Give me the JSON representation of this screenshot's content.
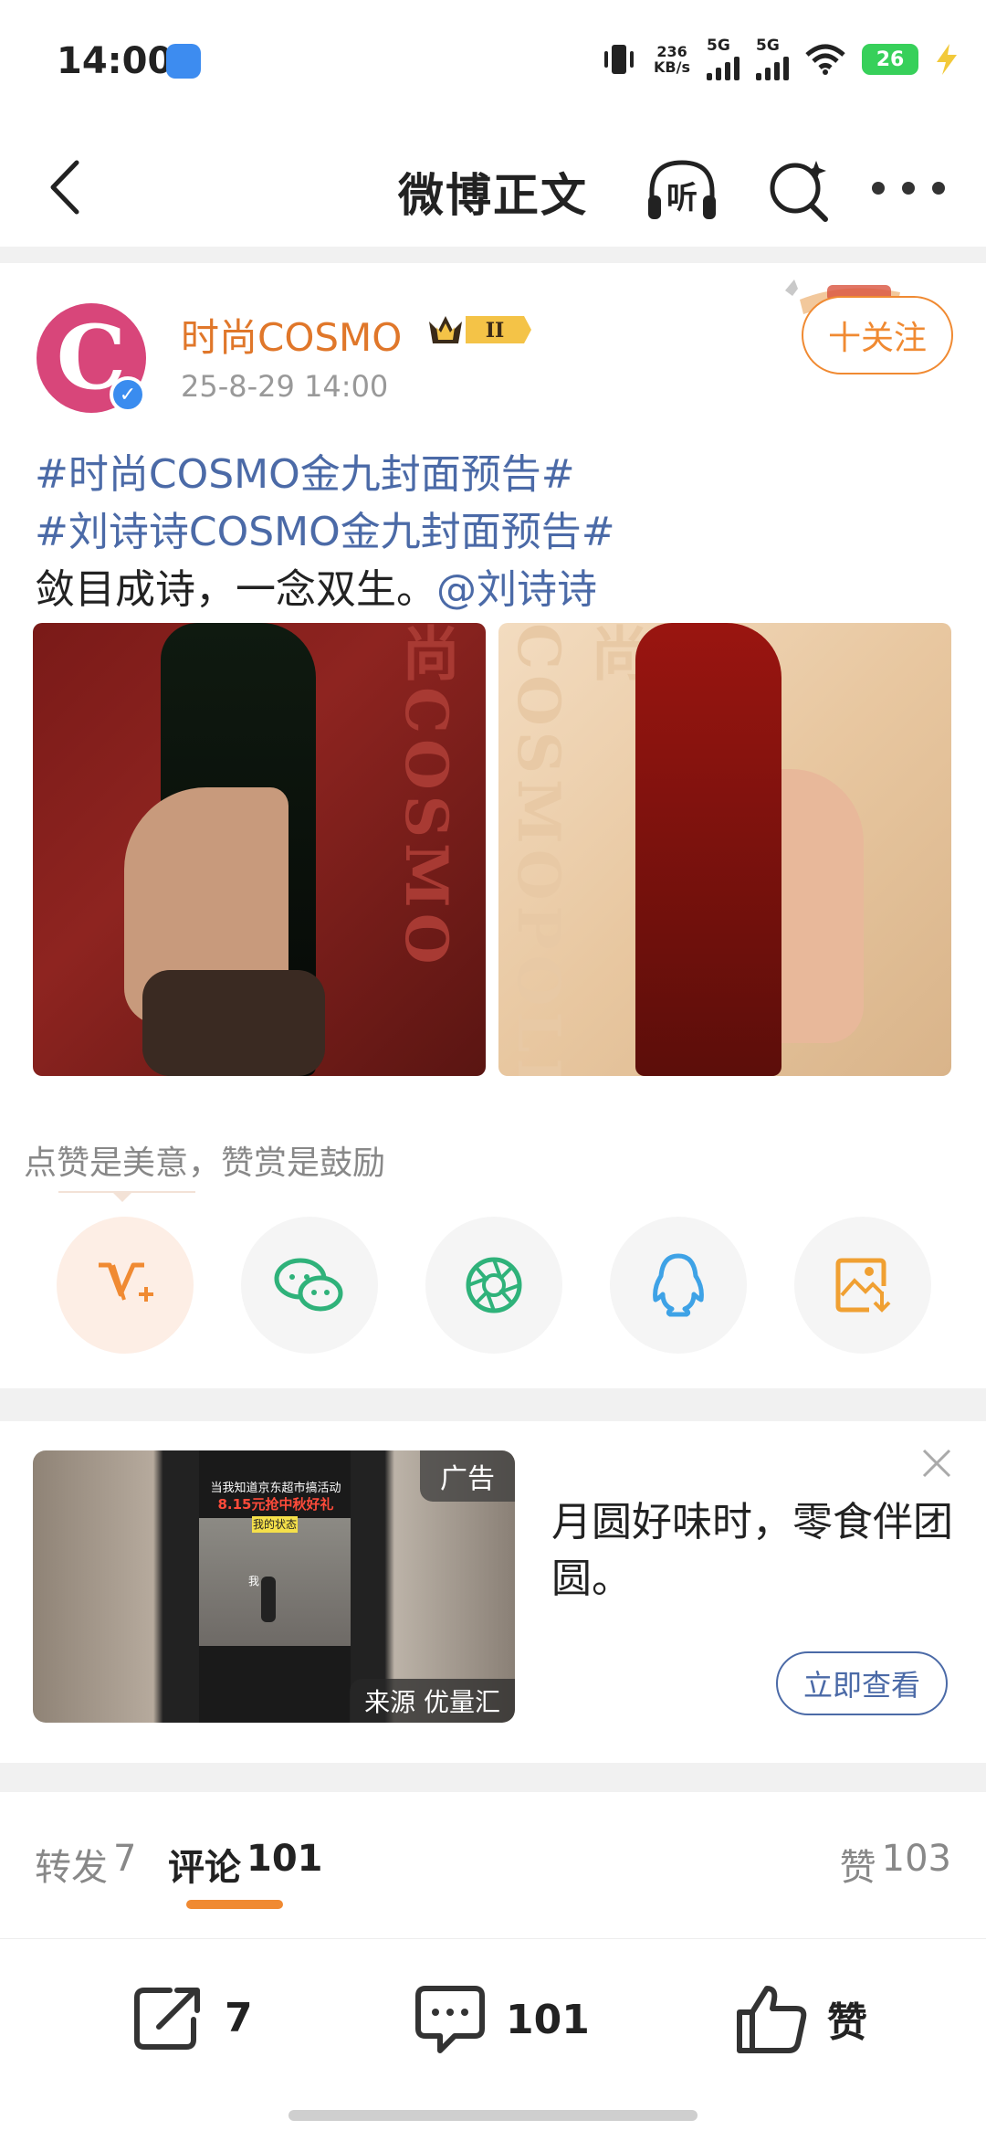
{
  "status_bar": {
    "time": "14:00",
    "net_speed_value": "236",
    "net_speed_unit": "KB/s",
    "sim1": "5G",
    "sim2": "5G",
    "battery": "26"
  },
  "nav": {
    "title": "微博正文",
    "listen_label": "听"
  },
  "post": {
    "author": "时尚COSMO",
    "vip_level": "II",
    "timestamp": "25-8-29 14:00",
    "follow_label": "十关注",
    "hashtag1": "#时尚COSMO金九封面预告#",
    "hashtag2": "#刘诗诗COSMO金九封面预告#",
    "body_text": "敛目成诗，一念双生。",
    "mention": "@刘诗诗",
    "image_watermark1": "尚COSMO",
    "image_watermark2": "尚COSMOPOLI"
  },
  "praise_tip": "点赞是美意，赞赏是鼓励",
  "share_targets": [
    "reward",
    "wechat",
    "moments",
    "qq",
    "save-image"
  ],
  "ad": {
    "badge": "广告",
    "source": "来源 优量汇",
    "title": "月圆好味时，零食伴团圆。",
    "cta": "立即查看",
    "video_caption1": "当我知道京东超市搞活动",
    "video_caption2": "8.15元抢中秋好礼",
    "video_caption3": "我的状态",
    "video_person_label": "我"
  },
  "tabs": {
    "repost_label": "转发",
    "repost_count": "7",
    "comment_label": "评论",
    "comment_count": "101",
    "like_label": "赞",
    "like_count": "103"
  },
  "bottom_bar": {
    "repost_count": "7",
    "comment_count": "101",
    "like_label": "赞"
  },
  "colors": {
    "accent_orange": "#f08a32",
    "link_blue": "#4b6aa7",
    "author_orange": "#e0772a"
  }
}
